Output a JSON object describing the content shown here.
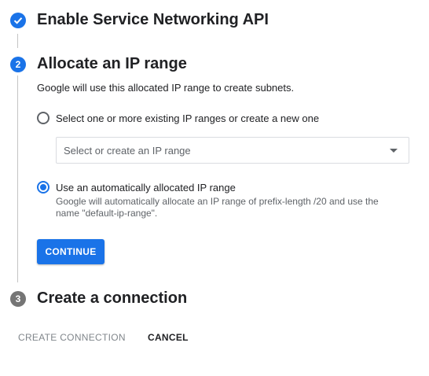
{
  "steps": [
    {
      "number": "✓",
      "title": "Enable Service Networking API",
      "state": "done"
    },
    {
      "number": "2",
      "title": "Allocate an IP range",
      "state": "active"
    },
    {
      "number": "3",
      "title": "Create a connection",
      "state": "pending"
    }
  ],
  "allocate": {
    "description": "Google will use this allocated IP range to create subnets.",
    "option_existing_label": "Select one or more existing IP ranges or create a new one",
    "select_placeholder": "Select or create an IP range",
    "option_auto_label": "Use an automatically allocated IP range",
    "option_auto_helper": "Google will automatically allocate an IP range of prefix-length /20 and use the name \"default-ip-range\".",
    "selected_option": "auto",
    "continue_label": "CONTINUE"
  },
  "footer": {
    "create_label": "CREATE CONNECTION",
    "cancel_label": "CANCEL"
  }
}
